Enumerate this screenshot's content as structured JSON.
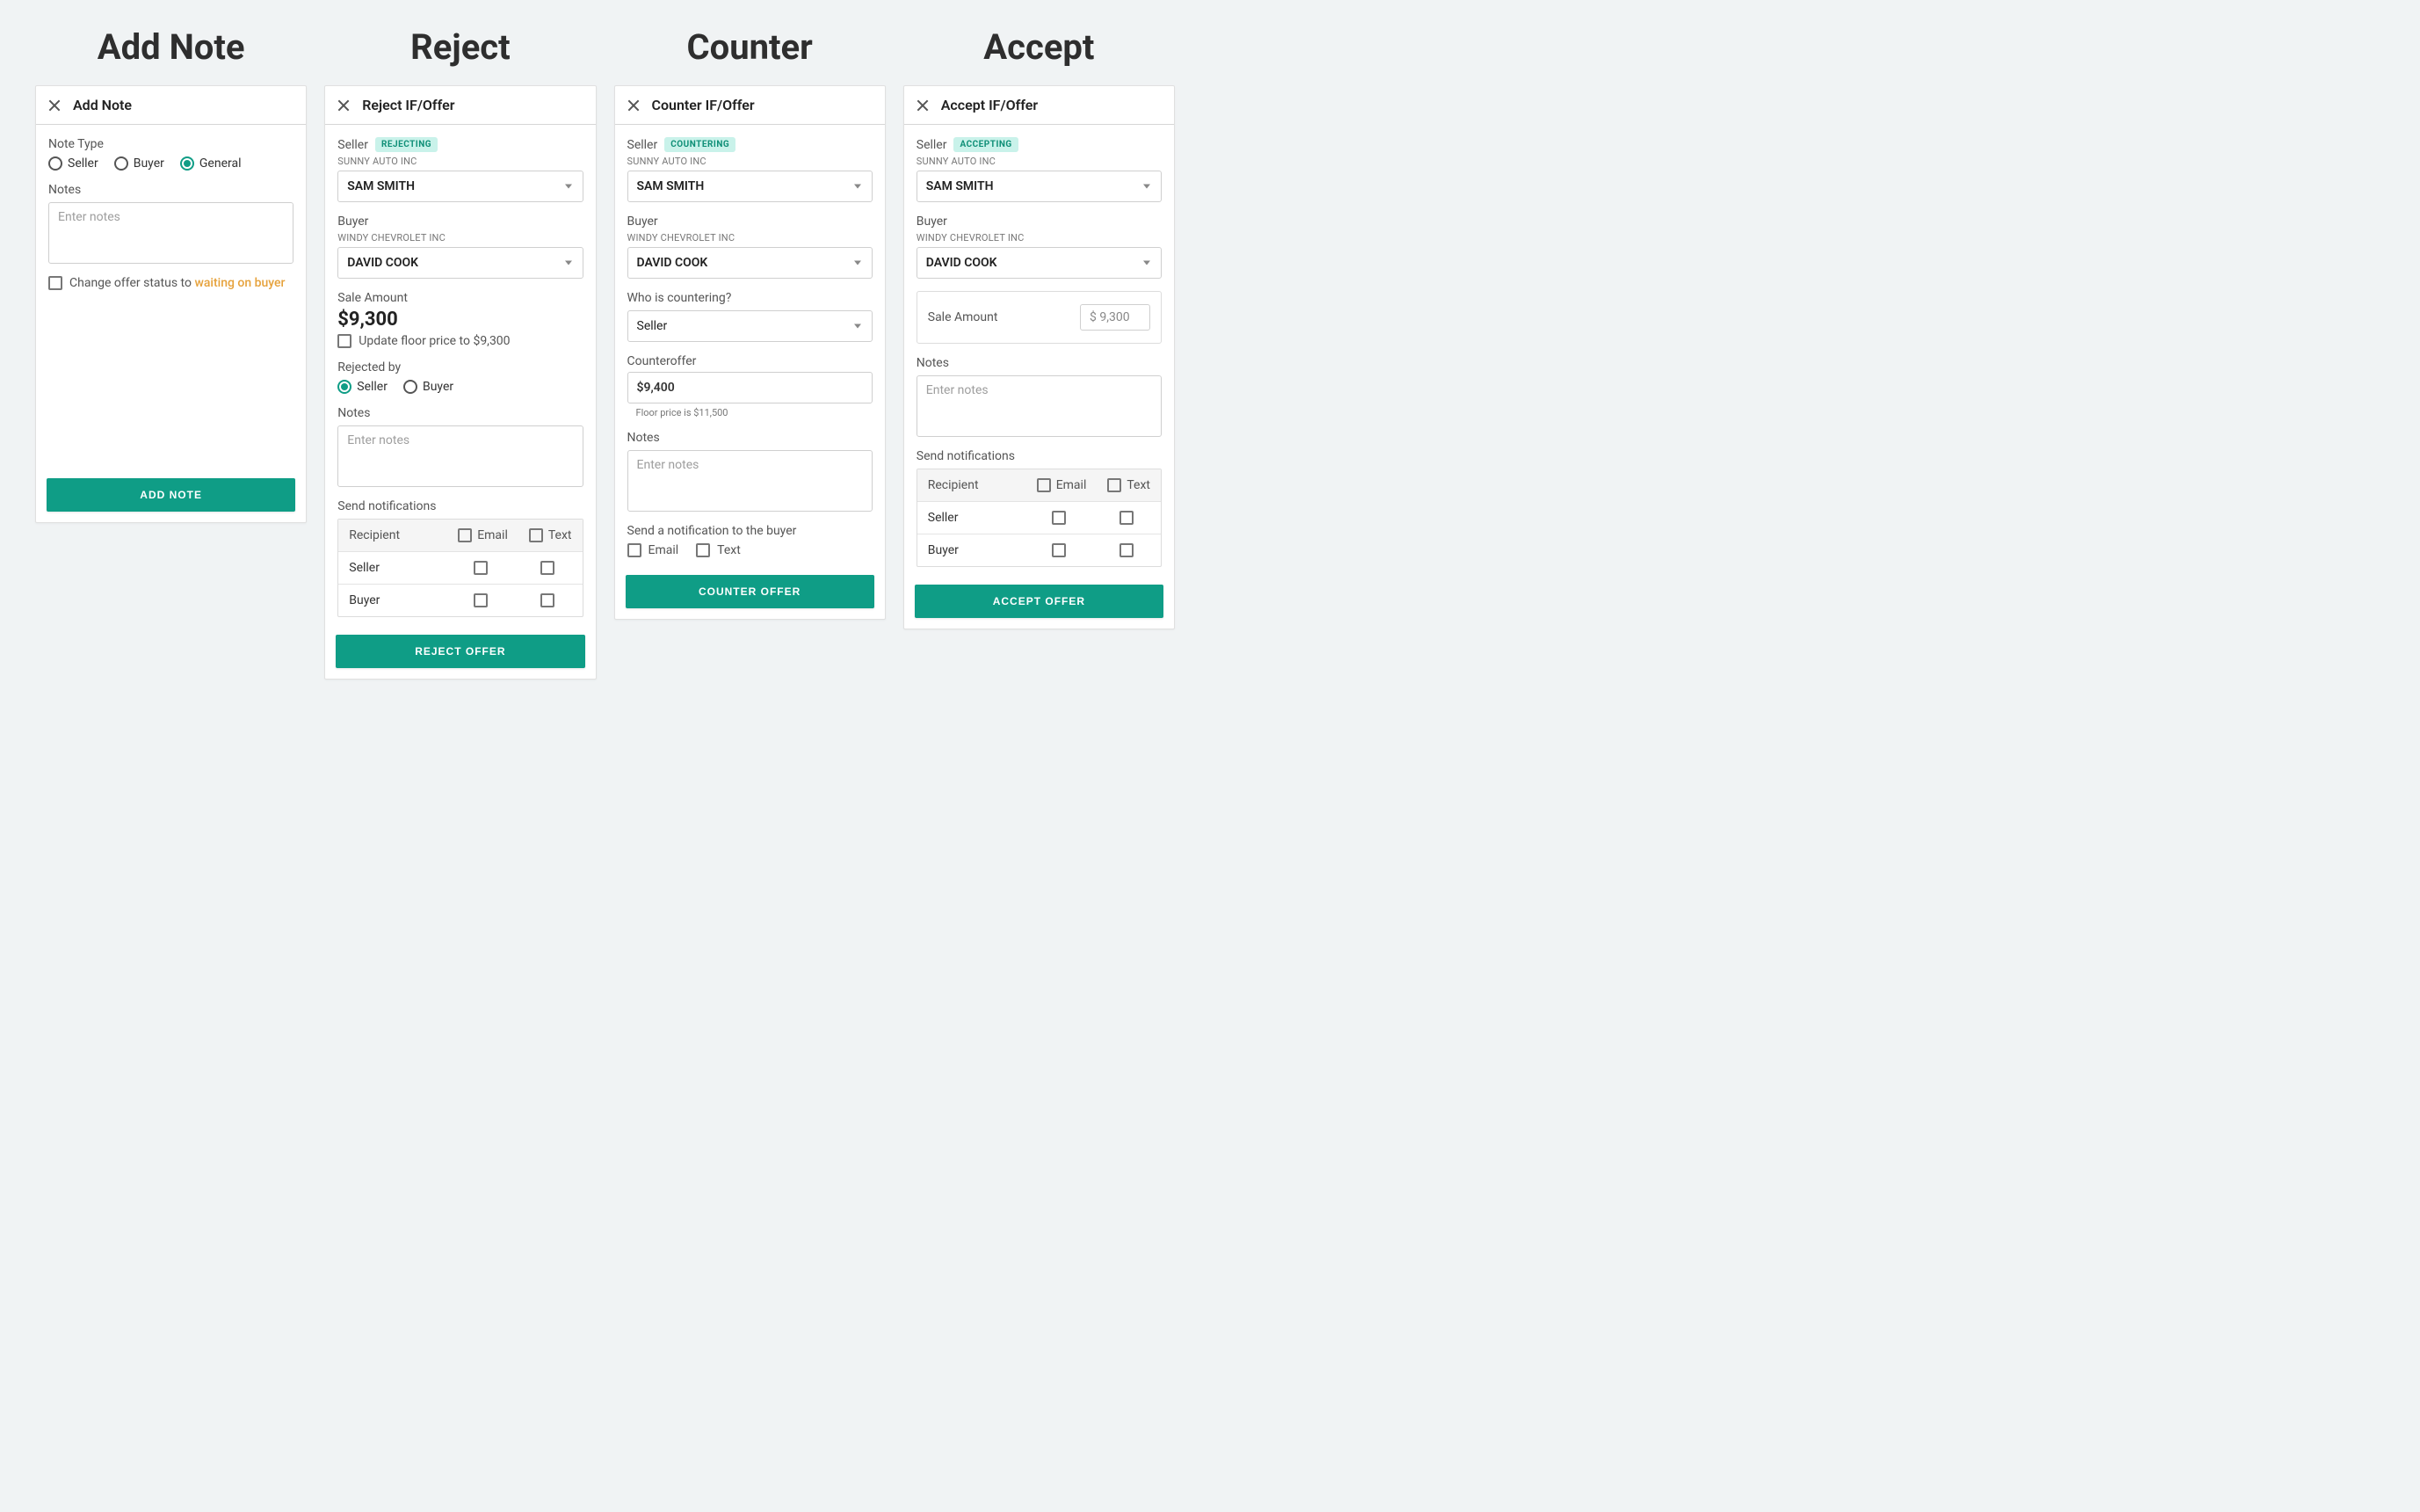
{
  "columns": {
    "add_note": "Add Note",
    "reject": "Reject",
    "counter": "Counter",
    "accept": "Accept"
  },
  "addNote": {
    "title": "Add Note",
    "noteTypeLabel": "Note Type",
    "noteTypes": {
      "seller": "Seller",
      "buyer": "Buyer",
      "general": "General"
    },
    "noteTypeSelected": "general",
    "notesLabel": "Notes",
    "notesPlaceholder": "Enter notes",
    "changeStatusPrefix": "Change offer status to ",
    "changeStatusHighlight": "waiting on buyer",
    "submit": "ADD NOTE"
  },
  "reject": {
    "title": "Reject IF/Offer",
    "sellerLabel": "Seller",
    "sellerBadge": "REJECTING",
    "sellerCompany": "SUNNY AUTO INC",
    "sellerSelected": "SAM SMITH",
    "buyerLabel": "Buyer",
    "buyerCompany": "WINDY CHEVROLET INC",
    "buyerSelected": "DAVID COOK",
    "saleAmountLabel": "Sale Amount",
    "saleAmount": "$9,300",
    "updateFloor": "Update floor price to $9,300",
    "rejectedByLabel": "Rejected by",
    "rejectedBy": {
      "seller": "Seller",
      "buyer": "Buyer"
    },
    "rejectedBySelected": "seller",
    "notesLabel": "Notes",
    "notesPlaceholder": "Enter notes",
    "sendNotifLabel": "Send notifications",
    "table": {
      "recipient": "Recipient",
      "email": "Email",
      "text": "Text",
      "seller": "Seller",
      "buyer": "Buyer"
    },
    "submit": "REJECT OFFER"
  },
  "counter": {
    "title": "Counter IF/Offer",
    "sellerLabel": "Seller",
    "sellerBadge": "COUNTERING",
    "sellerCompany": "SUNNY AUTO INC",
    "sellerSelected": "SAM SMITH",
    "buyerLabel": "Buyer",
    "buyerCompany": "WINDY CHEVROLET INC",
    "buyerSelected": "DAVID COOK",
    "whoLabel": "Who is countering?",
    "whoSelected": "Seller",
    "counterofferLabel": "Counteroffer",
    "counterofferValue": "$9,400",
    "floorHint": "Floor price is $11,500",
    "notesLabel": "Notes",
    "notesPlaceholder": "Enter notes",
    "sendNotifLabel": "Send a notification to the buyer",
    "notif": {
      "email": "Email",
      "text": "Text"
    },
    "submit": "COUNTER OFFER"
  },
  "accept": {
    "title": "Accept IF/Offer",
    "sellerLabel": "Seller",
    "sellerBadge": "ACCEPTING",
    "sellerCompany": "SUNNY AUTO INC",
    "sellerSelected": "SAM SMITH",
    "buyerLabel": "Buyer",
    "buyerCompany": "WINDY CHEVROLET INC",
    "buyerSelected": "DAVID COOK",
    "saleAmountLabel": "Sale Amount",
    "saleAmount": "$ 9,300",
    "notesLabel": "Notes",
    "notesPlaceholder": "Enter notes",
    "sendNotifLabel": "Send notifications",
    "table": {
      "recipient": "Recipient",
      "email": "Email",
      "text": "Text",
      "seller": "Seller",
      "buyer": "Buyer"
    },
    "submit": "ACCEPT OFFER"
  }
}
